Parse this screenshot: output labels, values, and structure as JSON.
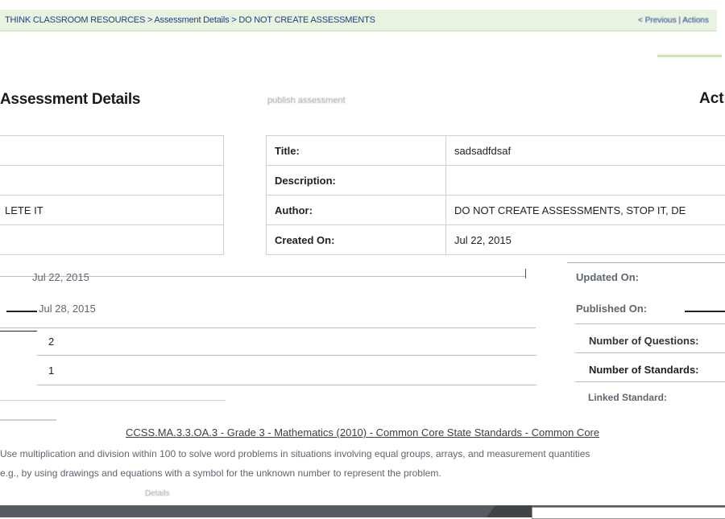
{
  "topbar": {
    "breadcrumb": "THINK CLASSROOM RESOURCES > Assessment Details > DO NOT CREATE ASSESSMENTS",
    "right_text": "< Previous | Actions"
  },
  "page": {
    "title": "Assessment Details",
    "subtitle": "publish assessment",
    "title_right": "Act"
  },
  "left_table": {
    "rows": [
      "",
      "",
      "LETE IT",
      ""
    ]
  },
  "details": {
    "title_label": "Title:",
    "title_value": "sadsadfdsaf",
    "description_label": "Description:",
    "description_value": "",
    "author_label": "Author:",
    "author_value": "DO NOT CREATE ASSESSMENTS, STOP IT, DE",
    "created_label": "Created On:",
    "created_value": "Jul 22, 2015"
  },
  "lower": {
    "updated_value": "Jul 22, 2015",
    "published_value": "Jul 28, 2015",
    "questions_value": "2",
    "standards_value": "1",
    "updated_label": "Updated On:",
    "published_label": "Published On:",
    "questions_label": "Number of Questions:",
    "standards_label": "Number of Standards:",
    "linked_label": "Linked Standard:"
  },
  "standards": {
    "code_line": "CCSS.MA.3.3.OA.3 - Grade 3 - Mathematics (2010) - Common Core State Standards - Common Core",
    "desc_line1": "Use multiplication and division within 100 to solve word problems in situations involving equal groups, arrays, and measurement quantities",
    "desc_line2": "e.g., by using drawings and equations with a symbol for the unknown number to represent the problem.",
    "desc_line3": "Details"
  }
}
